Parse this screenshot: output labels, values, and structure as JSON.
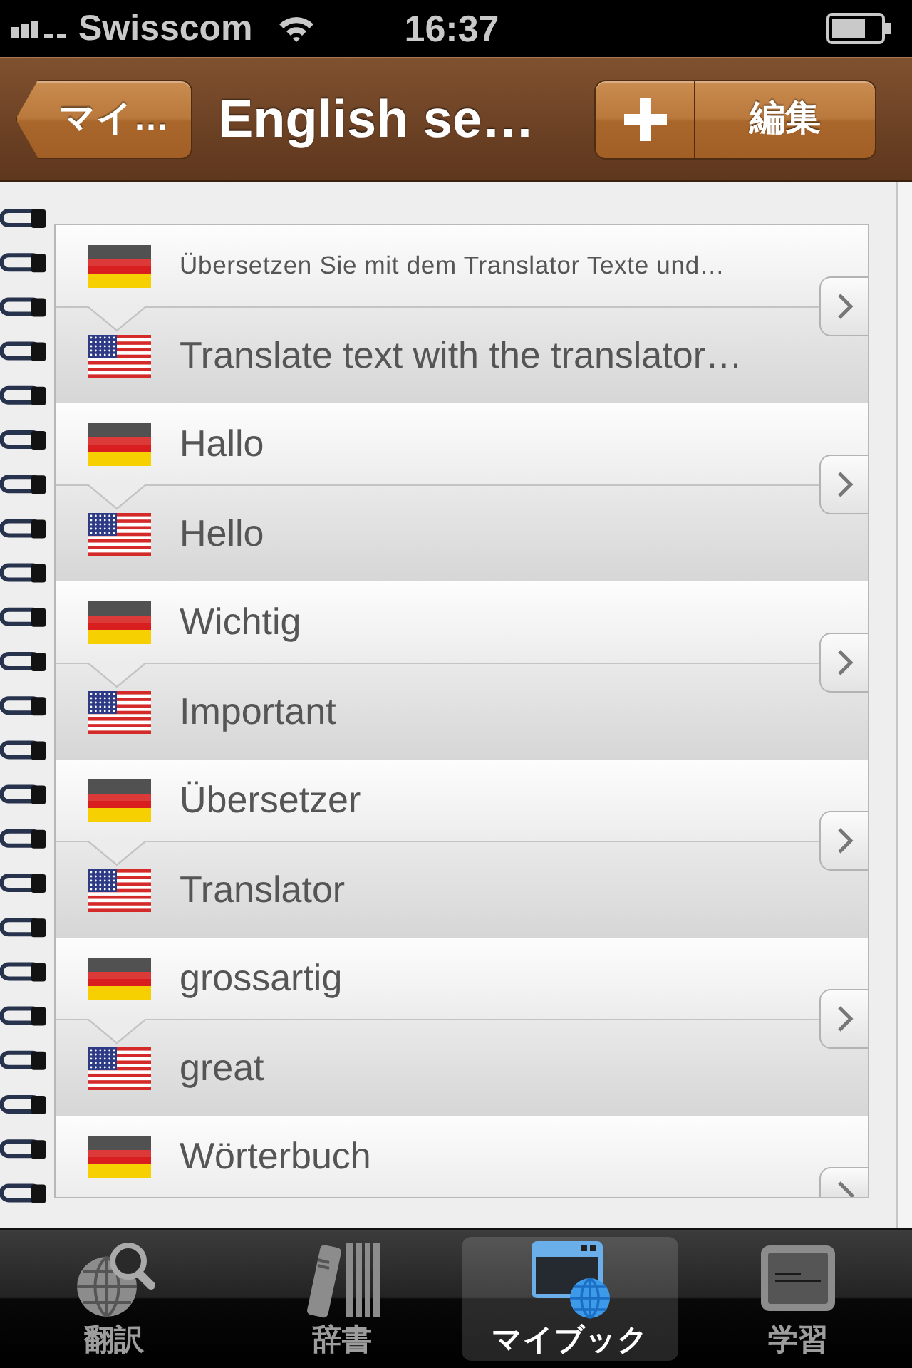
{
  "status_bar": {
    "carrier": "Swisscom",
    "time": "16:37"
  },
  "nav_bar": {
    "back_button": "マイ…",
    "title": "English se…",
    "edit_button": "編集"
  },
  "entries": [
    {
      "kind": "phrase",
      "source": "Übersetzen Sie mit dem Translator Texte und…",
      "target": "Translate text with the translator…"
    },
    {
      "kind": "word",
      "source": "Hallo",
      "target": "Hello"
    },
    {
      "kind": "word",
      "source": "Wichtig",
      "target": "Important"
    },
    {
      "kind": "word",
      "source": "Übersetzer",
      "target": "Translator"
    },
    {
      "kind": "word",
      "source": "grossartig",
      "target": "great"
    },
    {
      "kind": "word",
      "source": "Wörterbuch"
    }
  ],
  "tab_bar": [
    {
      "label": "翻訳",
      "selected": false
    },
    {
      "label": "辞書",
      "selected": false
    },
    {
      "label": "マイブック",
      "selected": true
    },
    {
      "label": "学習",
      "selected": false
    }
  ]
}
